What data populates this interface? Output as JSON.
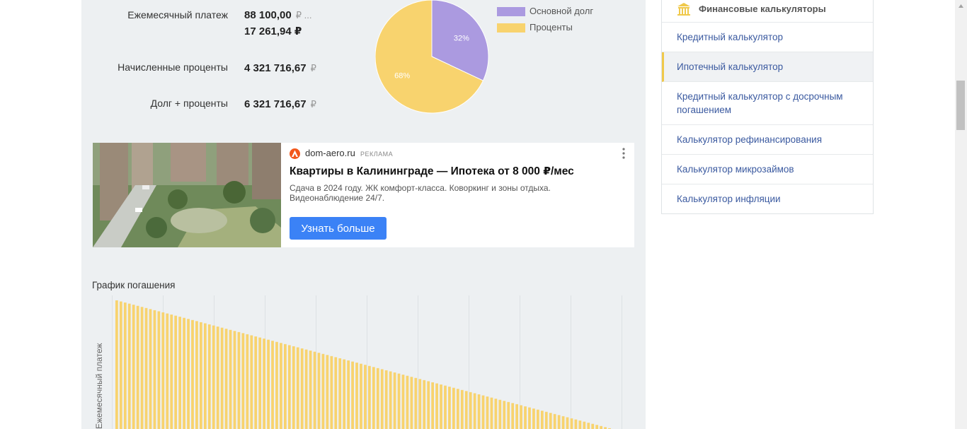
{
  "summary": {
    "monthly_label": "Ежемесячный платеж",
    "monthly_value_1": "88 100,00",
    "monthly_value_1_suffix": "₽ ...",
    "monthly_value_2": "17 261,94 ₽",
    "interest_label": "Начисленные проценты",
    "interest_value": "4 321 716,67",
    "total_label": "Долг + проценты",
    "total_value": "6 321 716,67",
    "currency": "₽"
  },
  "pie": {
    "slices": [
      {
        "name": "Основной долг",
        "percent": 32,
        "label": "32%",
        "color": "#ab9ae0"
      },
      {
        "name": "Проценты",
        "percent": 68,
        "label": "68%",
        "color": "#f8d36e"
      }
    ]
  },
  "ad": {
    "domain": "dom-aero.ru",
    "tag": "РЕКЛАМА",
    "title": "Квартиры в Калининграде — Ипотека от 8 000 ₽/мес",
    "description": "Сдача в 2024 году. ЖК комфорт-класса. Коворкинг и зоны отдыха. Видеонаблюдение 24/7.",
    "button": "Узнать больше"
  },
  "chart": {
    "title": "График погашения",
    "ylabel": "Ежемесячный платеж",
    "bar_color": "#f8d36e"
  },
  "chart_data": {
    "type": "bar",
    "title": "График погашения",
    "xlabel": "",
    "ylabel": "Ежемесячный платеж",
    "bar_count": 120,
    "trend": "linearly decreasing monthly payment (differentiated schedule)",
    "start_fraction_visible": 1.0,
    "end_fraction_visible": 0.0
  },
  "sidebar": {
    "title": "Финансовые калькуляторы",
    "items": [
      {
        "label": "Кредитный калькулятор",
        "active": false
      },
      {
        "label": "Ипотечный калькулятор",
        "active": true
      },
      {
        "label": "Кредитный калькулятор с досрочным погашением",
        "active": false
      },
      {
        "label": "Калькулятор рефинансирования",
        "active": false
      },
      {
        "label": "Калькулятор микрозаймов",
        "active": false
      },
      {
        "label": "Калькулятор инфляции",
        "active": false
      }
    ]
  }
}
